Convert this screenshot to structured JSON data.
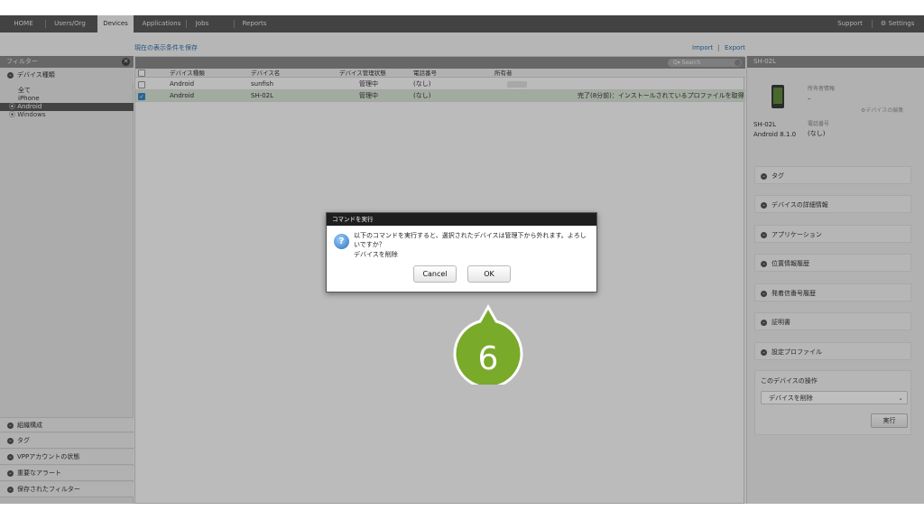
{
  "nav": {
    "items": [
      "HOME",
      "Users/Org",
      "Devices",
      "Applications",
      "Jobs",
      "Reports"
    ],
    "support": "Support",
    "settings": "Settings"
  },
  "subbar": {
    "save_view": "現在の表示条件を保存",
    "import": "Import",
    "separator": "|",
    "export": "Export"
  },
  "sidebar": {
    "header": "フィルター",
    "device_type_section": "デバイス種類",
    "device_types": [
      "全て",
      "iPhone",
      "Android",
      "Windows"
    ],
    "selected_device_type": "Android",
    "bottom_sections": [
      "組織構成",
      "タグ",
      "VPPアカウントの状態",
      "重要なアラート",
      "保存されたフィルター"
    ]
  },
  "search": {
    "placeholder": "Q▾ Search"
  },
  "table": {
    "columns": [
      "デバイス種類",
      "デバイス名",
      "デバイス管理状態",
      "電話番号",
      "所有者"
    ],
    "rows": [
      {
        "type": "Android",
        "name": "sunfish",
        "status": "管理中",
        "phone": "(なし)",
        "owner": "",
        "note": "",
        "checked": false
      },
      {
        "type": "Android",
        "name": "SH-02L",
        "status": "管理中",
        "phone": "(なし)",
        "owner": "",
        "note": "完了(8分前)：インストールされているプロファイルを取得",
        "checked": true
      }
    ]
  },
  "detail": {
    "header": "SH-02L",
    "owner_label": "所有者情報",
    "owner_value": "–",
    "edit_link": "デバイスの編集",
    "device_name": "SH-02L",
    "os": "Android 8.1.0",
    "phone_label": "電話番号",
    "phone_value": "(なし)",
    "sections": [
      "タグ",
      "デバイスの詳細情報",
      "アプリケーション",
      "位置情報履歴",
      "発着信番号履歴",
      "証明書",
      "設定プロファイル"
    ],
    "operation_title": "このデバイスの操作",
    "operation_selected": "デバイスを削除",
    "run_button": "実行"
  },
  "dialog": {
    "title": "コマンドを実行",
    "message": "以下のコマンドを実行すると、選択されたデバイスは管理下から外れます。よろしいですか？",
    "command": "デバイスを削除",
    "cancel": "Cancel",
    "ok": "OK"
  },
  "callout": {
    "number": "6",
    "color": "#79aa2a"
  }
}
